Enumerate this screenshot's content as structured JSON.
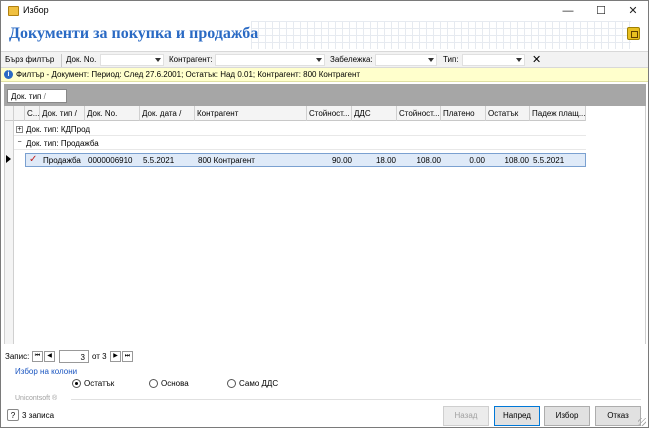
{
  "window": {
    "title": "Избор",
    "minimize": "—",
    "maximize": "☐",
    "close": "✕"
  },
  "header": {
    "title": "Документи за покупка и продажба"
  },
  "quick_filter": {
    "label": "Бърз филтър",
    "doc_no_label": "Док. No.",
    "contragent_label": "Контрагент:",
    "note_label": "Забележка:",
    "type_label": "Тип:",
    "clear": "✕"
  },
  "filter_bar": {
    "text": "Филтър - Документ: Период: След 27.6.2001; Остатък: Над 0.01; Контрагент: 800 Контрагент"
  },
  "group_panel": {
    "chip": "Док. тип"
  },
  "grid": {
    "columns": [
      "С...",
      "Док. тип",
      "Док. No.",
      "Док. дата",
      "Контрагент",
      "Стойност...",
      "ДДС",
      "Стойност...",
      "Платено",
      "Остатък",
      "Падеж плащ..."
    ],
    "groups": [
      {
        "label": "Док. тип: КДПрод",
        "toggle": "+"
      },
      {
        "label": "Док. тип: Продажба",
        "toggle": "−"
      }
    ],
    "row": {
      "status": "✓",
      "doc_type": "Продажба",
      "doc_no": "0000006910",
      "doc_date": "5.5.2021",
      "contragent": "800 Контрагент",
      "value": "90.00",
      "vat": "18.00",
      "total": "108.00",
      "paid": "0.00",
      "remaining": "108.00",
      "due": "5.5.2021"
    }
  },
  "navigator": {
    "label": "Запис:",
    "page": "3",
    "of_text": "от 3",
    "first": "⏮",
    "prev": "◀",
    "next": "▶",
    "last": "⏭"
  },
  "column_link": "Избор на колони",
  "options": {
    "remaining": "Остатък",
    "base": "Основа",
    "vat_only": "Само ДДС",
    "selected": "remaining"
  },
  "brand": "Unicontsoft ®",
  "status": {
    "help": "?",
    "count": "3 записа"
  },
  "buttons": {
    "back": "Назад",
    "next": "Напред",
    "select": "Избор",
    "cancel": "Отказ"
  }
}
